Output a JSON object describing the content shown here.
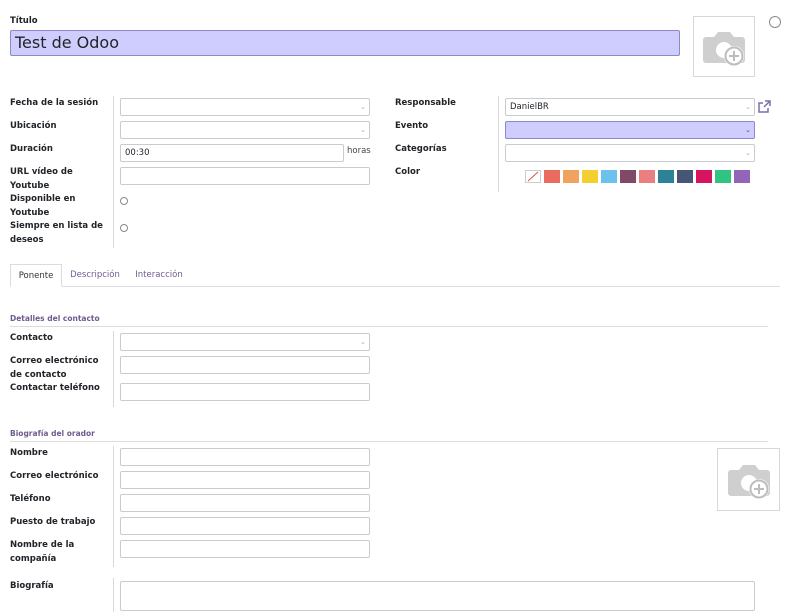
{
  "title": {
    "label": "Título",
    "value": "Test de Odoo"
  },
  "left_fields": {
    "session_date": {
      "label": "Fecha de la sesión",
      "value": ""
    },
    "location": {
      "label": "Ubicación",
      "value": ""
    },
    "duration": {
      "label": "Duración",
      "value": "00:30",
      "unit": "horas"
    },
    "youtube_url": {
      "label_1": "URL vídeo de",
      "label_2": "Youtube",
      "value": ""
    },
    "available_youtube": {
      "label_1": "Disponible en",
      "label_2": "Youtube"
    },
    "always_wishlist": {
      "label_1": "Siempre en lista de",
      "label_2": "deseos"
    }
  },
  "right_fields": {
    "responsible": {
      "label": "Responsable",
      "value": "DanielBR"
    },
    "event": {
      "label": "Evento",
      "value": ""
    },
    "categories": {
      "label": "Categorías",
      "value": ""
    },
    "color": {
      "label": "Color"
    }
  },
  "colors": [
    "#ffffff",
    "#eb6b5e",
    "#f0a35f",
    "#f4cf30",
    "#6cc1ed",
    "#814968",
    "#eb7e7f",
    "#2c8397",
    "#475577",
    "#d6145f",
    "#30c381",
    "#9365b8"
  ],
  "tabs": [
    {
      "label": "Ponente",
      "active": true
    },
    {
      "label": "Descripción",
      "active": false
    },
    {
      "label": "Interacción",
      "active": false
    }
  ],
  "contact_section": {
    "heading": "Detalles del contacto",
    "contact": {
      "label": "Contacto",
      "value": ""
    },
    "contact_email": {
      "label_1": "Correo electrónico",
      "label_2": "de contacto",
      "value": ""
    },
    "contact_phone": {
      "label": "Contactar teléfono",
      "value": ""
    }
  },
  "speaker_section": {
    "heading": "Biografía del orador",
    "name": {
      "label": "Nombre",
      "value": ""
    },
    "email": {
      "label": "Correo electrónico",
      "value": ""
    },
    "phone": {
      "label": "Teléfono",
      "value": ""
    },
    "job": {
      "label": "Puesto de trabajo",
      "value": ""
    },
    "company": {
      "label_1": "Nombre de la",
      "label_2": "compañía",
      "value": ""
    },
    "bio": {
      "label": "Biografía",
      "value": ""
    }
  }
}
